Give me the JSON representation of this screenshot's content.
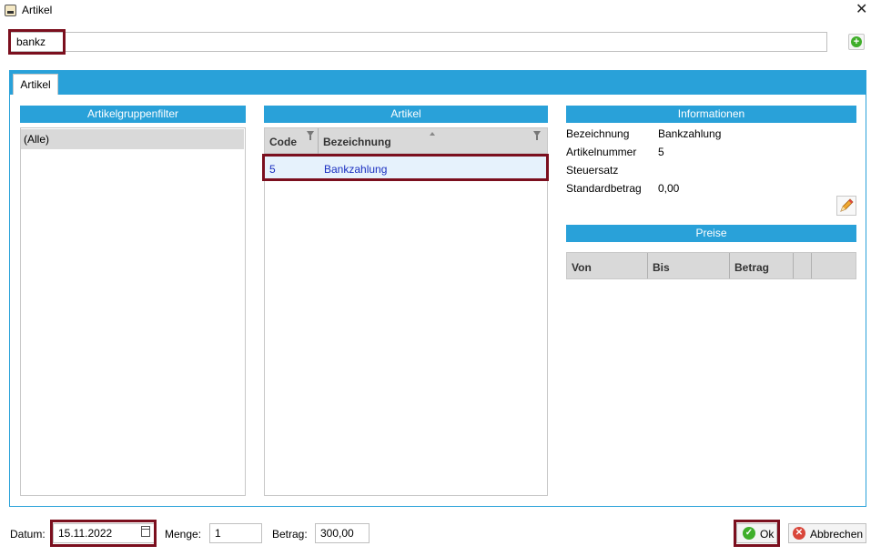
{
  "window": {
    "title": "Artikel"
  },
  "search": {
    "value": "bankz"
  },
  "tabs": [
    {
      "label": "Artikel"
    }
  ],
  "panels": {
    "groups": {
      "header": "Artikelgruppenfilter",
      "items": [
        "(Alle)"
      ]
    },
    "articles": {
      "header": "Artikel",
      "columns": [
        "Code",
        "Bezeichnung"
      ],
      "rows": [
        {
          "code": "5",
          "name": "Bankzahlung"
        }
      ]
    },
    "info": {
      "header": "Informationen",
      "fields": [
        {
          "label": "Bezeichnung",
          "value": "Bankzahlung"
        },
        {
          "label": "Artikelnummer",
          "value": "5"
        },
        {
          "label": "Steuersatz",
          "value": ""
        },
        {
          "label": "Standardbetrag",
          "value": "0,00"
        }
      ]
    },
    "prices": {
      "header": "Preise",
      "columns": [
        "Von",
        "Bis",
        "Betrag"
      ]
    }
  },
  "footer": {
    "date_label": "Datum:",
    "date_value": "15.11.2022",
    "qty_label": "Menge:",
    "qty_value": "1",
    "amount_label": "Betrag:",
    "amount_value": "300,00",
    "ok_label": "Ok",
    "cancel_label": "Abbrechen"
  },
  "colors": {
    "accent": "#29a1d9",
    "highlight": "#7b0f1e",
    "link": "#1a2fc0",
    "ok_green": "#3fae2a",
    "cancel_red": "#d9463a"
  }
}
